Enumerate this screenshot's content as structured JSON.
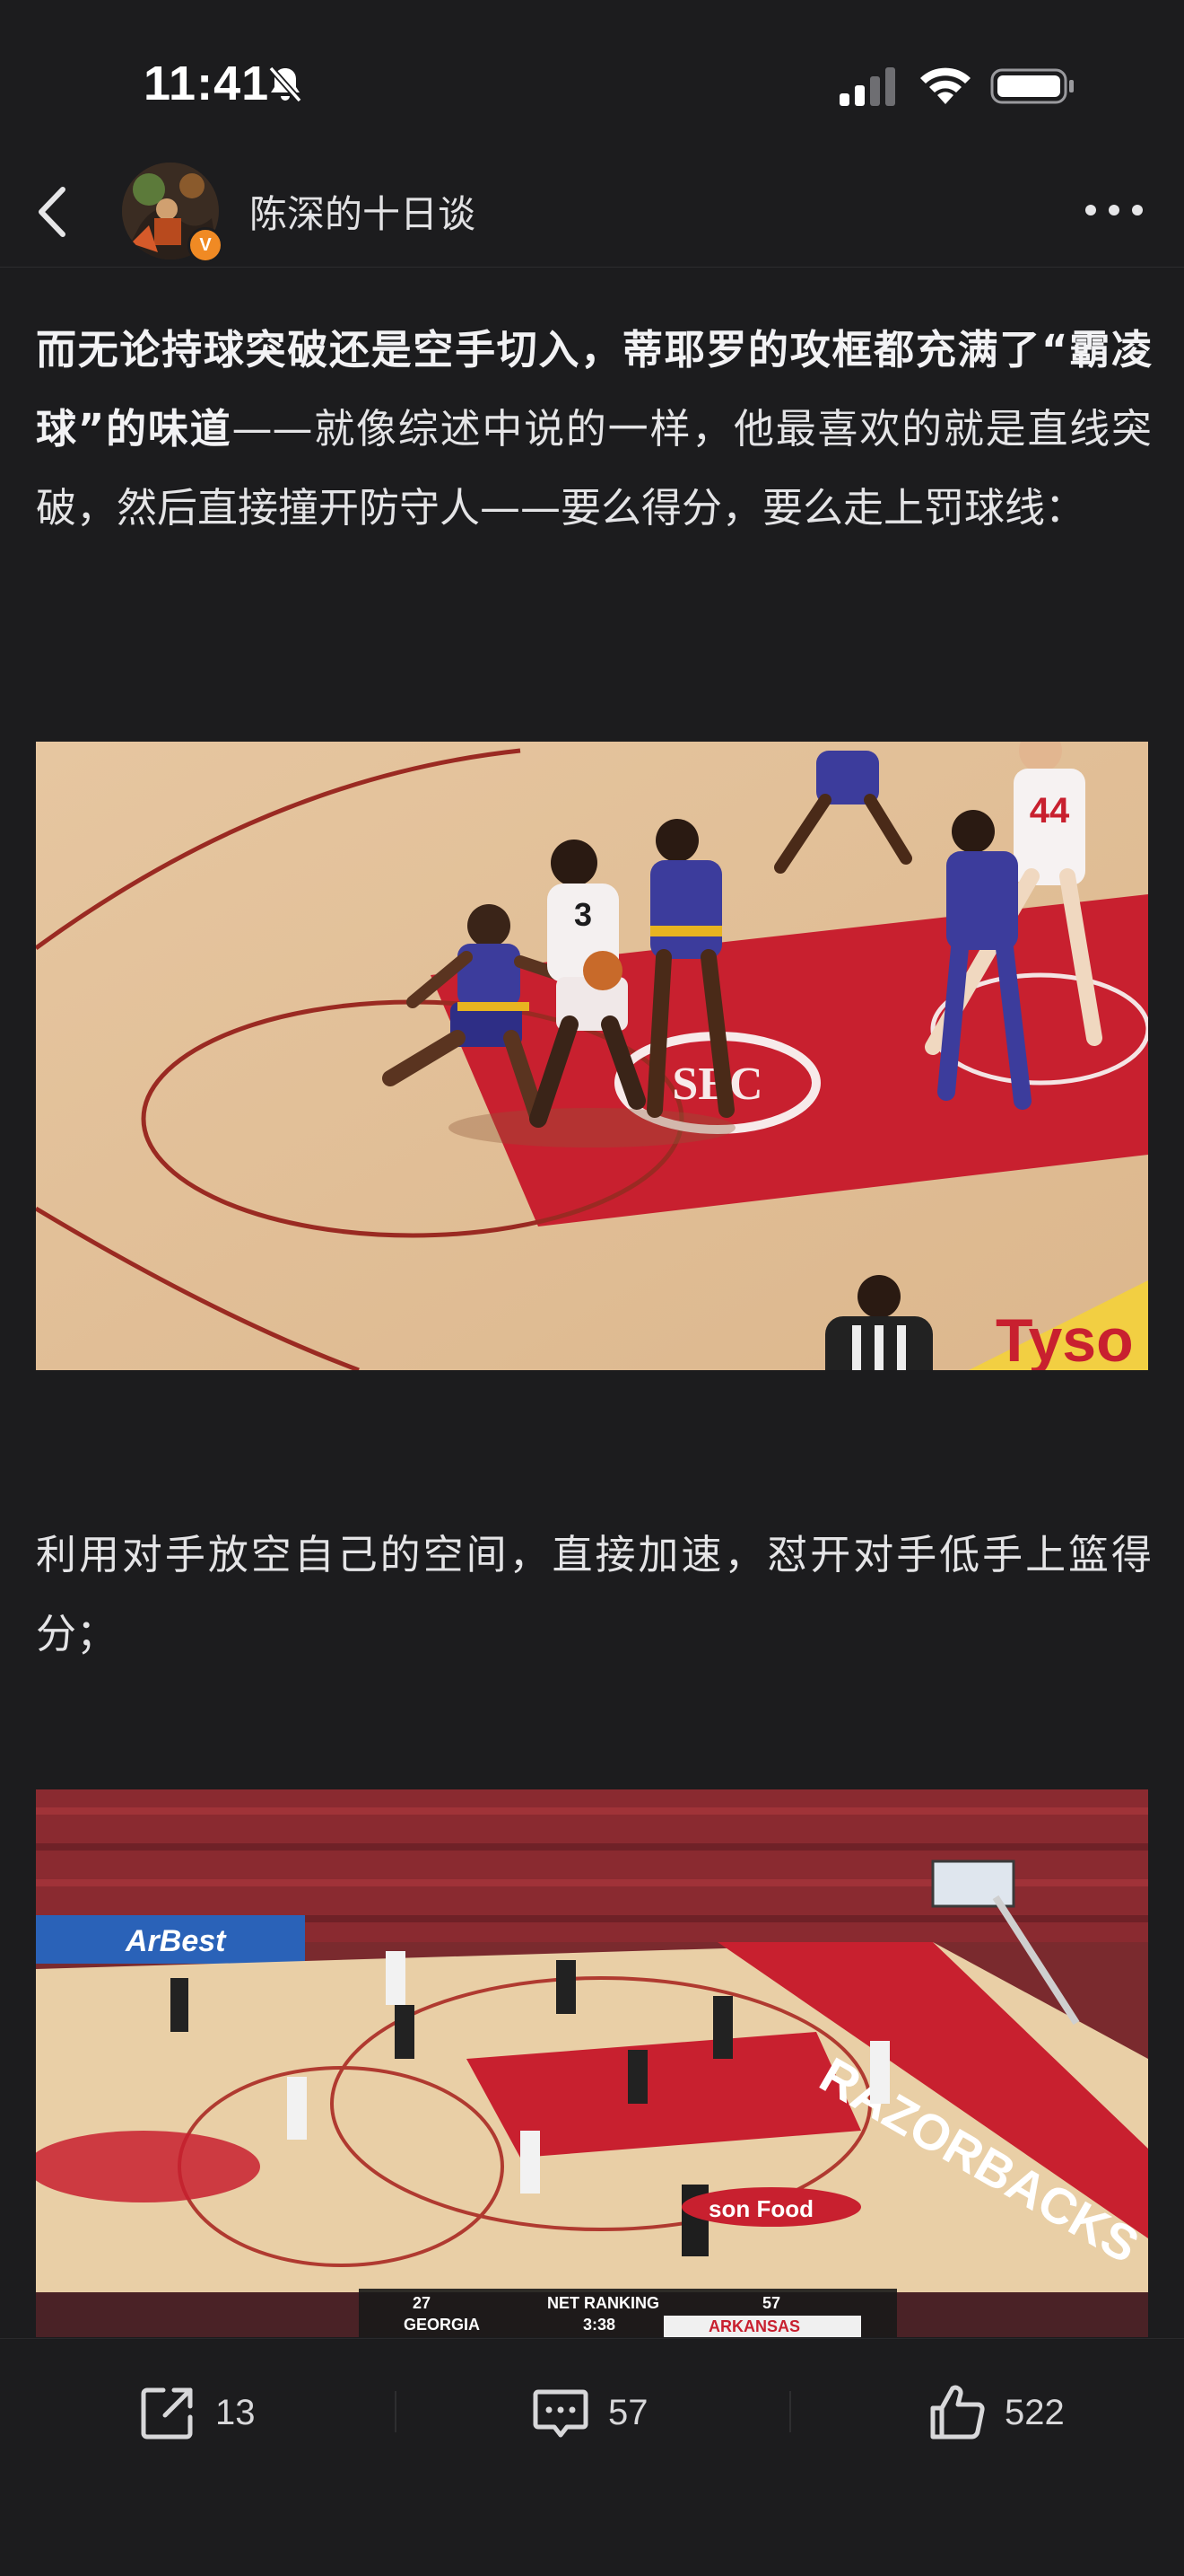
{
  "status_bar": {
    "time": "11:41",
    "icons": [
      "bell-muted-icon",
      "cellular-signal-icon",
      "wifi-icon",
      "battery-icon"
    ]
  },
  "header": {
    "back_icon": "chevron-left-icon",
    "author_name": "陈深的十日谈",
    "verified_badge": "V",
    "more_icon": "more-dots-icon"
  },
  "article": {
    "para1_bold": "而无论持球突破还是空手切入，蒂耶罗的攻框都充满了“霸凌球”的味道",
    "para1_rest": "——就像综述中说的一样，他最喜欢的就是直线突破，然后直接撞开防守人——要么得分，要么走上罚球线：",
    "para2": "利用对手放空自己的空间，直接加速，怼开对手低手上篮得分；",
    "figure1": {
      "jersey_numbers": [
        "3",
        "44"
      ],
      "floor_text": "Tyso"
    },
    "figure2": {
      "floor_text": "RAZORBACKS",
      "banner_text": "ArBest",
      "floor_sponsor": "son Food",
      "scoreboard": {
        "left_rank": "27",
        "center_label": "NET RANKING",
        "right_rank": "57",
        "team_left": "GEORGIA",
        "clock": "3:38",
        "team_right": "ARKANSAS"
      }
    }
  },
  "toolbar": {
    "share_icon": "share-icon",
    "share_count": "13",
    "comment_icon": "comment-icon",
    "comment_count": "57",
    "like_icon": "thumbs-up-icon",
    "like_count": "522"
  },
  "colors": {
    "background": "#1c1c1e",
    "text": "#e4e4e6",
    "badge": "#f08a24",
    "court_red": "#c8202f",
    "court_wood": "#e9c9a4"
  }
}
